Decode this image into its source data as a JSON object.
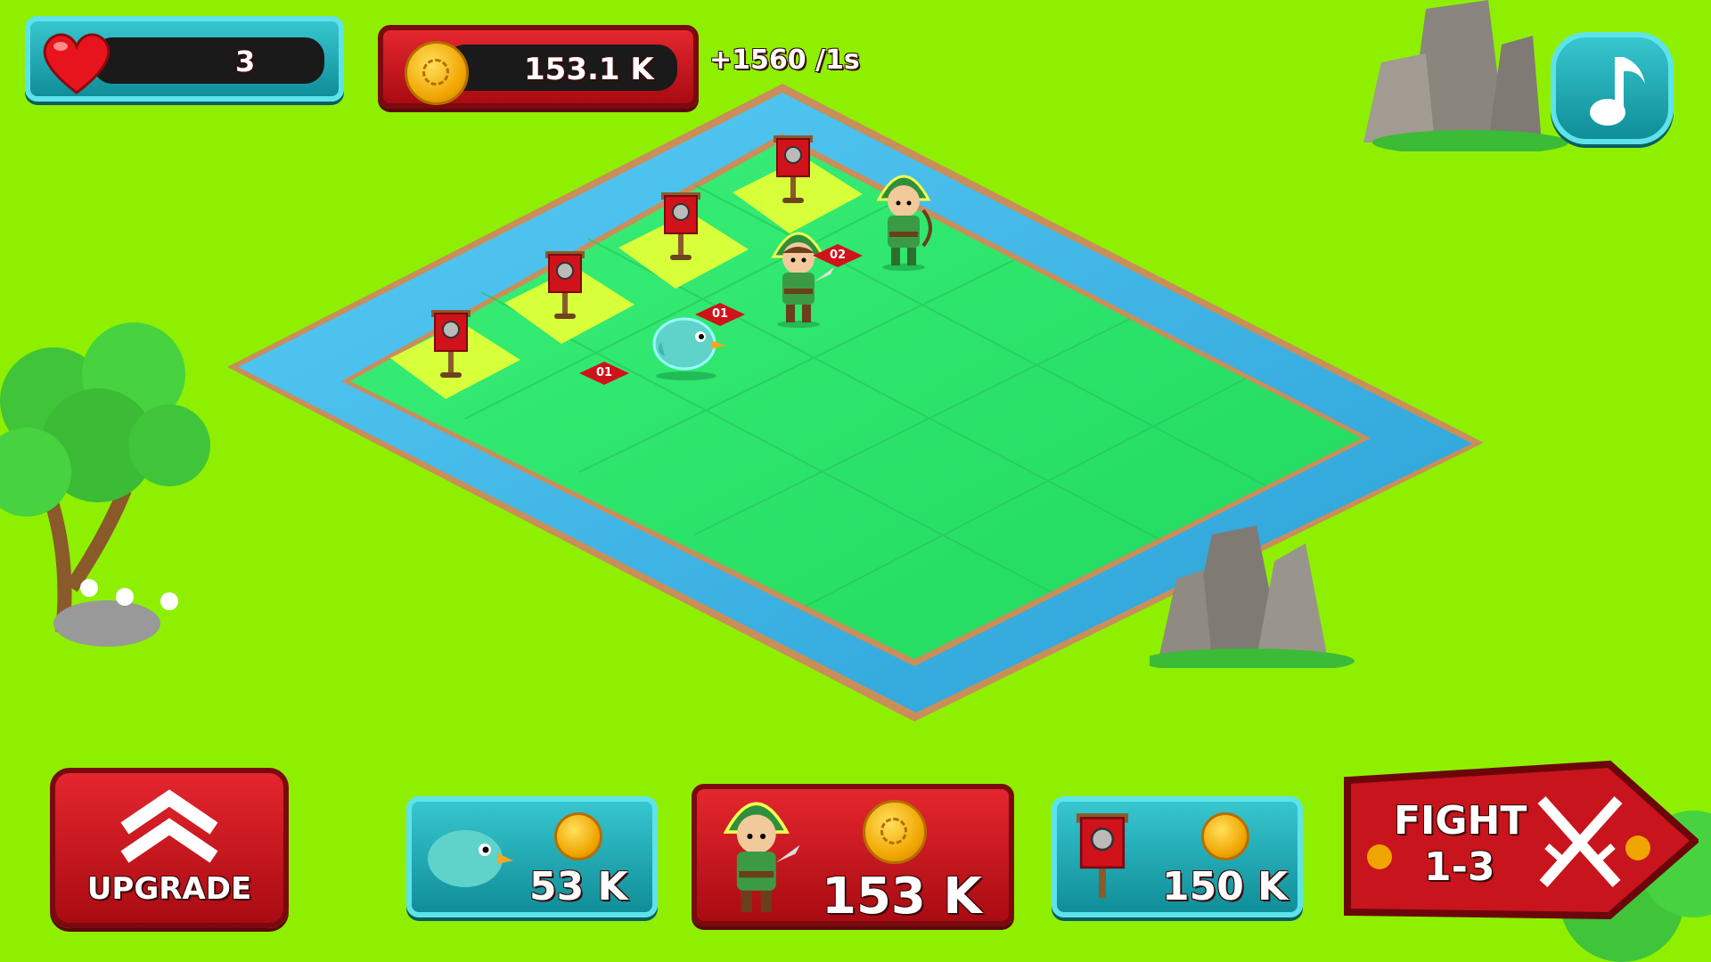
{
  "hud": {
    "lives_value": "3",
    "coins_value": "153.1 K",
    "income_rate": "+1560 /1s"
  },
  "board": {
    "tile_labels": [
      "01",
      "01",
      "02"
    ]
  },
  "shop": {
    "upgrade_label": "UPGRADE",
    "units": [
      {
        "name": "bird",
        "cost": "53 K"
      },
      {
        "name": "archer",
        "cost": "153 K"
      },
      {
        "name": "banner",
        "cost": "150 K"
      }
    ],
    "fight_label_line1": "FIGHT",
    "fight_label_line2": "1-3"
  },
  "icons": {
    "lives": "heart-icon",
    "coins": "coin-icon",
    "music": "music-note-icon",
    "fight": "crossed-swords-icon",
    "upgrade": "chevron-up-icon"
  },
  "colors": {
    "background": "#8ef000",
    "teal_panel": "#1aa7b1",
    "red_panel": "#c8141c",
    "water": "#3fb8e8",
    "grass_tile": "#2ee66a",
    "highlight_tile": "#d7ff3a"
  }
}
